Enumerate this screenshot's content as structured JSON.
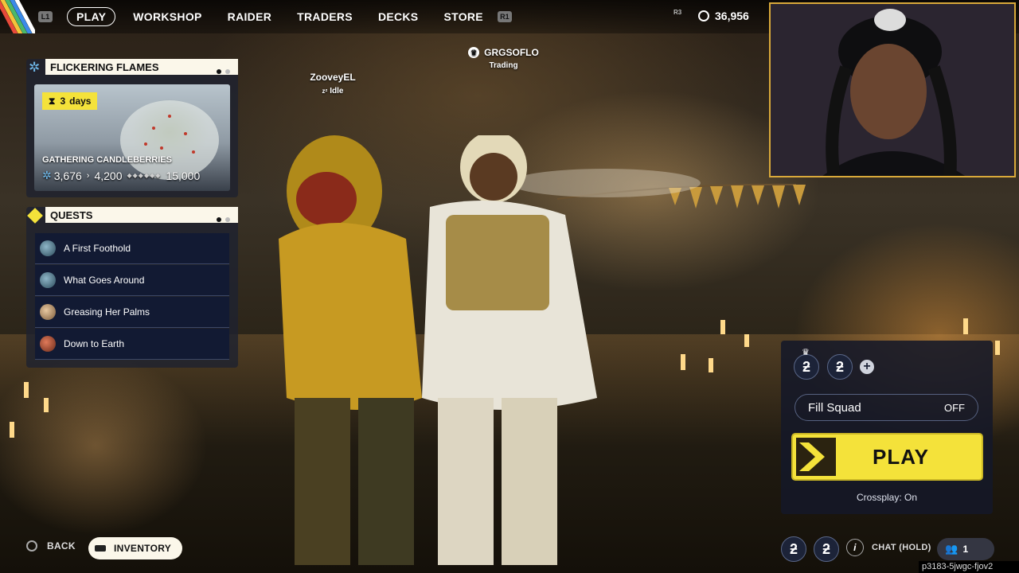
{
  "nav": {
    "left_button": "L1",
    "items": [
      "PLAY",
      "WORKSHOP",
      "RAIDER",
      "TRADERS",
      "DECKS",
      "STORE"
    ],
    "active": "PLAY",
    "right_button": "R1",
    "r3_hint": "R3",
    "currency_value": "36,956",
    "currency_icon": "coin-icon"
  },
  "event": {
    "title": "FLICKERING FLAMES",
    "days_count": "3",
    "days_unit": "days",
    "name": "GATHERING CANDLEBERRIES",
    "current": "3,676",
    "next": "4,200",
    "max": "15,000"
  },
  "quests": {
    "title": "QUESTS",
    "items": [
      {
        "label": "A First Foothold"
      },
      {
        "label": "What Goes Around"
      },
      {
        "label": "Greasing Her Palms"
      },
      {
        "label": "Down to Earth"
      }
    ]
  },
  "players": [
    {
      "name": "ZooveyEL",
      "status": "Idle"
    },
    {
      "name": "GRGSOFLO",
      "status": "Trading"
    }
  ],
  "squad": {
    "fill_squad_label": "Fill Squad",
    "fill_squad_value": "OFF",
    "play_label": "PLAY",
    "crossplay": "Crossplay: On"
  },
  "bottom": {
    "back_label": "BACK",
    "inventory_label": "INVENTORY",
    "chat_label": "CHAT (HOLD)",
    "friends_count": "1",
    "session_id": "p3183-5jwgc-fjov2"
  },
  "colors": {
    "accent_yellow": "#f4e23a",
    "panel_header": "#fbf7ea",
    "webcam_border": "#d9a93a"
  }
}
